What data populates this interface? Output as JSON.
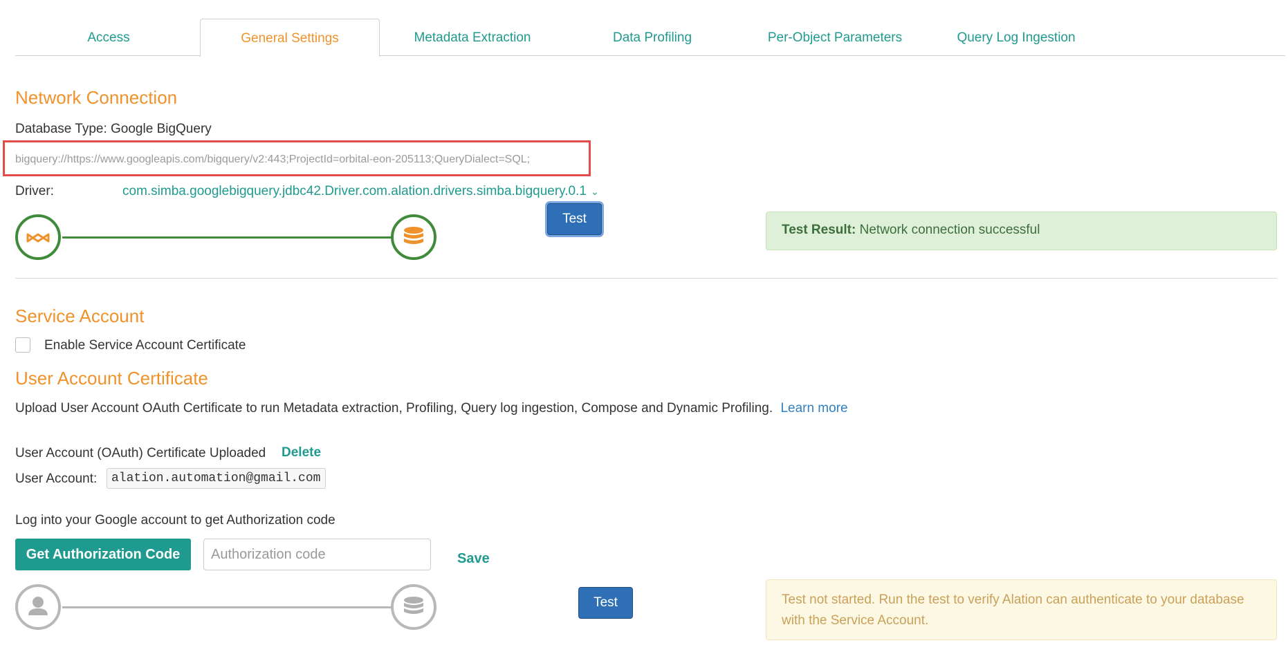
{
  "tabs": [
    {
      "label": "Access"
    },
    {
      "label": "General Settings"
    },
    {
      "label": "Metadata Extraction"
    },
    {
      "label": "Data Profiling"
    },
    {
      "label": "Per-Object Parameters"
    },
    {
      "label": "Query Log Ingestion"
    }
  ],
  "active_tab": "General Settings",
  "network": {
    "title": "Network Connection",
    "db_type": "Database Type: Google BigQuery",
    "uri": "bigquery://https://www.googleapis.com/bigquery/v2:443;ProjectId=orbital-eon-205113;QueryDialect=SQL;",
    "driver_label": "Driver:",
    "driver_value": "com.simba.googlebigquery.jdbc42.Driver.com.alation.drivers.simba.bigquery.0.1",
    "test_label": "Test",
    "result_label": "Test Result:",
    "result_text": "Network connection successful"
  },
  "service_account": {
    "title": "Service Account",
    "checkbox_label": "Enable Service Account Certificate",
    "checked": false
  },
  "user_cert": {
    "title": "User Account Certificate",
    "description": "Upload User Account OAuth Certificate to run Metadata extraction, Profiling, Query log ingestion, Compose and Dynamic Profiling.",
    "learn_more": "Learn more",
    "uploaded_text": "User Account (OAuth) Certificate Uploaded",
    "delete_label": "Delete",
    "account_label": "User Account:",
    "account_value": "alation.automation@gmail.com",
    "login_hint": "Log into your Google account to get Authorization code",
    "get_code_label": "Get Authorization Code",
    "auth_placeholder": "Authorization code",
    "save_label": "Save",
    "test_label": "Test",
    "result_text": "Test not started. Run the test to verify Alation can authenticate to your database with the Service Account."
  },
  "colors": {
    "accent_orange": "#f0922b",
    "teal": "#1f9a8e",
    "success_green": "#3f8b3a",
    "button_blue": "#2f6fb6"
  },
  "icons": [
    "connector-icon",
    "database-icon",
    "user-icon",
    "database-icon",
    "chevron-down-icon"
  ]
}
